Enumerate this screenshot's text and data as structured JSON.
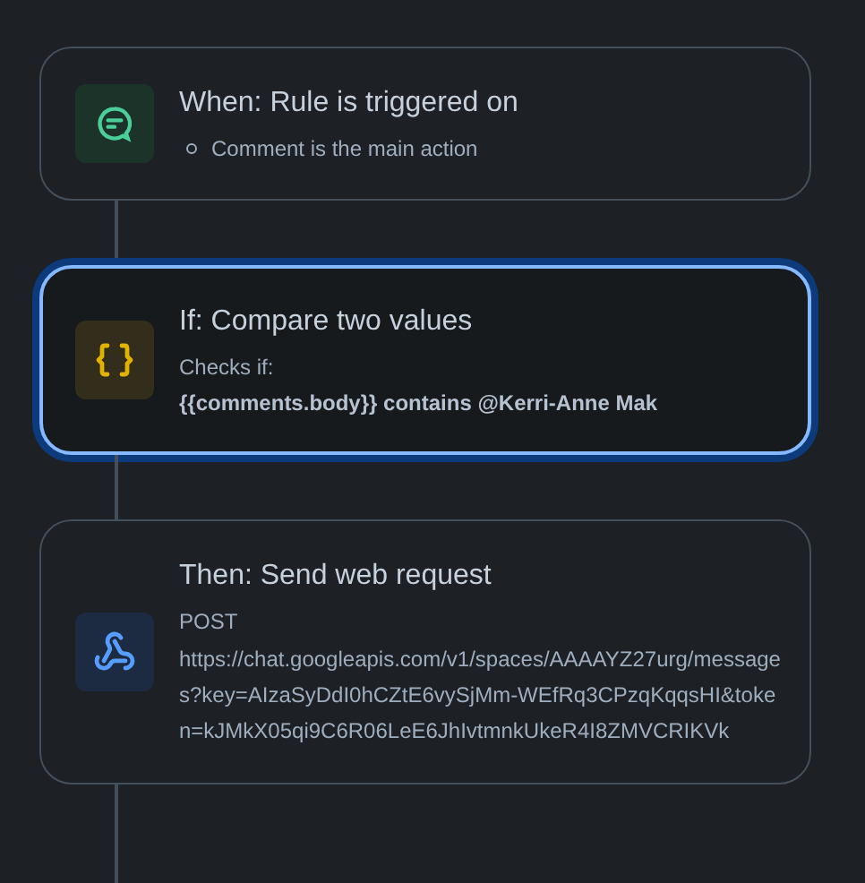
{
  "steps": [
    {
      "kind": "trigger",
      "selected": false,
      "title": "When: Rule is triggered on",
      "bullets": [
        "Comment is the main action"
      ]
    },
    {
      "kind": "condition",
      "selected": true,
      "title": "If: Compare two values",
      "label": "Checks if:",
      "condition": "{{comments.body}} contains @Kerri-Anne Mak"
    },
    {
      "kind": "action",
      "selected": false,
      "title": "Then: Send web request",
      "method": "POST",
      "url": "https://chat.googleapis.com/v1/spaces/AAAAYZ27urg/messages?key=AIzaSyDdI0hCZtE6vySjMm-WEfRq3CPzqKqqsHI&token=kJMkX05qi9C6R06LeE6JhIvtmnkUkeR4I8ZMVCRIKVk"
    }
  ]
}
